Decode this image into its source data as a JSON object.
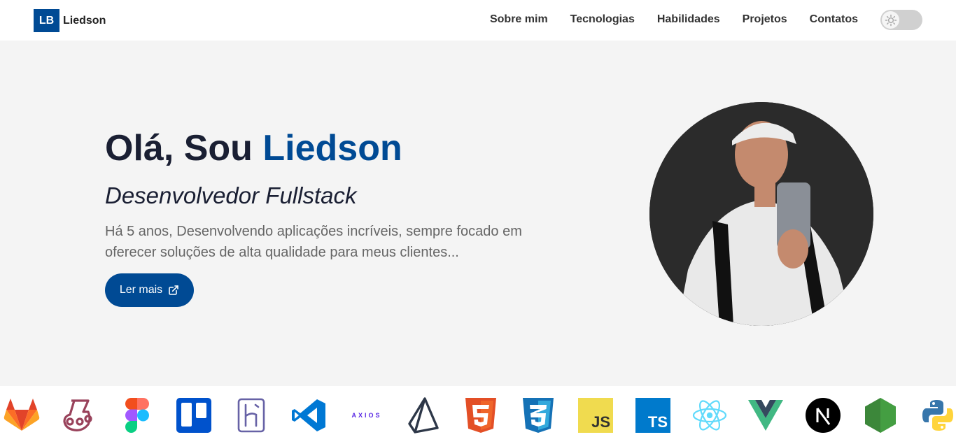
{
  "nav": {
    "logo_initials": "LB",
    "logo_name": "Liedson",
    "links": [
      "Sobre mim",
      "Tecnologias",
      "Habilidades",
      "Projetos",
      "Contatos"
    ]
  },
  "hero": {
    "greeting": "Olá, Sou ",
    "name": "Liedson",
    "subtitle": "Desenvolvedor Fullstack",
    "description": "Há 5 anos, Desenvolvendo aplicações incríveis, sempre focado em oferecer soluções de alta qualidade para meus clientes...",
    "button_label": "Ler mais"
  },
  "tech": {
    "axios_label": "AXIOS",
    "js_label": "JS",
    "ts_label": "TS",
    "icons": [
      "gitlab-icon",
      "jest-icon",
      "figma-icon",
      "trello-icon",
      "heroku-icon",
      "vscode-icon",
      "axios-icon",
      "prisma-icon",
      "html5-icon",
      "css3-icon",
      "javascript-icon",
      "typescript-icon",
      "react-icon",
      "vue-icon",
      "nextjs-icon",
      "nodejs-icon",
      "python-icon"
    ]
  },
  "colors": {
    "primary": "#004a94",
    "background": "#f4f4f4",
    "text_dark": "#1a1f33",
    "text_muted": "#666666"
  }
}
